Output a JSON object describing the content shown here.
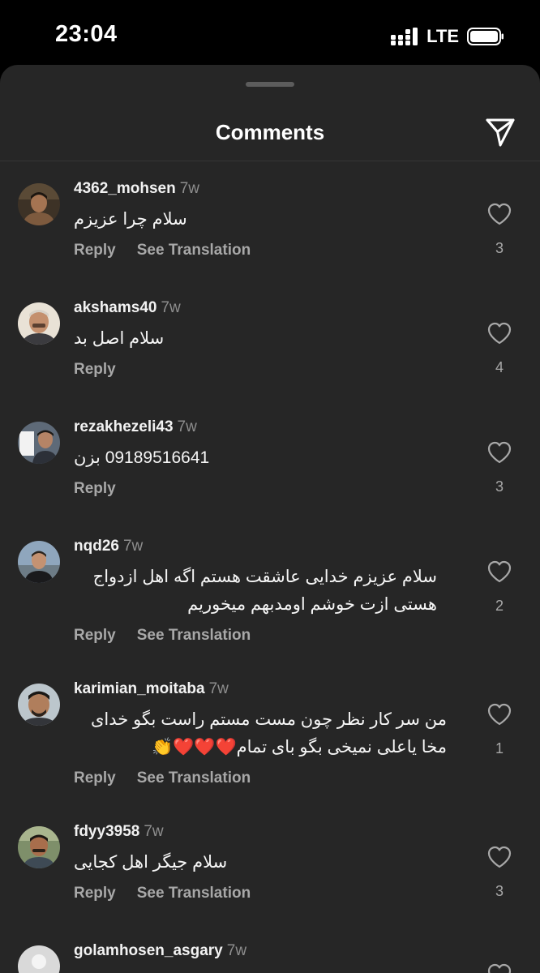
{
  "status_bar": {
    "time": "23:04",
    "network": "LTE"
  },
  "sheet": {
    "title": "Comments"
  },
  "colors": {
    "background": "#262626",
    "status_bar": "#000000",
    "secondary_text": "#a8a8a8",
    "timestamp": "#8e8e8e",
    "heart_emoji": "#e0262e"
  },
  "icons": {
    "share": "paper-plane-icon",
    "like": "heart-outline-icon",
    "signal": "signal-dots-icon",
    "battery": "battery-icon"
  },
  "comments": [
    {
      "username": "4362_mohsen",
      "time": "7w",
      "lines": [
        "سلام چرا عزیزم"
      ],
      "reply": "Reply",
      "see_translation": "See Translation",
      "likes": "3"
    },
    {
      "username": "akshams40",
      "time": "7w",
      "lines": [
        "سلام اصل بد"
      ],
      "reply": "Reply",
      "likes": "4"
    },
    {
      "username": "rezakhezeli43",
      "time": "7w",
      "lines": [
        "09189516641 بزن"
      ],
      "reply": "Reply",
      "likes": "3"
    },
    {
      "username": "nqd26",
      "time": "7w",
      "lines": [
        "سلام عزیزم خدایی عاشقت هستم اگه اهل ازدواج",
        "هستی  ازت خوشم اومدبهم میخوریم"
      ],
      "reply": "Reply",
      "see_translation": "See Translation",
      "likes": "2"
    },
    {
      "username": "karimian_moitaba",
      "time": "7w",
      "lines": [
        "من سر کار نظر چون مست مستم راست بگو خدای",
        "مخا یاعلی نمیخی بگو بای تمام❤️❤️❤️👏"
      ],
      "reply": "Reply",
      "see_translation": "See Translation",
      "likes": "1"
    },
    {
      "username": "fdyy3958",
      "time": "7w",
      "lines": [
        "سلام جیگر اهل کجایی"
      ],
      "reply": "Reply",
      "see_translation": "See Translation",
      "likes": "3"
    },
    {
      "username": "golamhosen_asgary",
      "time": "7w"
    }
  ]
}
